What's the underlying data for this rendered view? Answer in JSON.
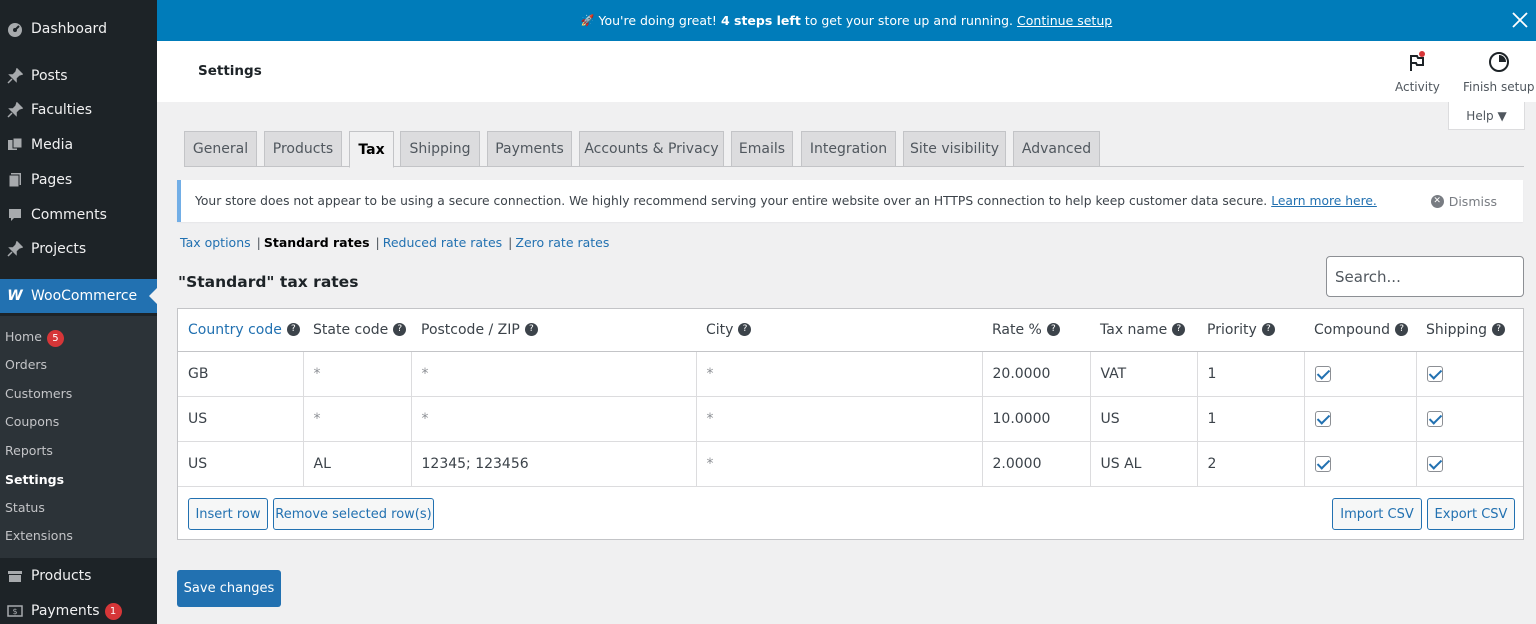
{
  "sidebar": {
    "items": [
      {
        "label": "Dashboard",
        "icon": "dashboard-icon"
      },
      {
        "label": "Posts",
        "icon": "pin-icon"
      },
      {
        "label": "Faculties",
        "icon": "pin-icon"
      },
      {
        "label": "Media",
        "icon": "media-icon"
      },
      {
        "label": "Pages",
        "icon": "pages-icon"
      },
      {
        "label": "Comments",
        "icon": "comments-icon"
      },
      {
        "label": "Projects",
        "icon": "pin-icon"
      },
      {
        "label": "WooCommerce",
        "icon": "woo-icon"
      },
      {
        "label": "Products",
        "icon": "products-icon"
      },
      {
        "label": "Payments",
        "icon": "payments-icon",
        "badge": "1"
      }
    ],
    "submenu": [
      {
        "label": "Home",
        "badge": "5"
      },
      {
        "label": "Orders"
      },
      {
        "label": "Customers"
      },
      {
        "label": "Coupons"
      },
      {
        "label": "Reports"
      },
      {
        "label": "Settings",
        "current": true
      },
      {
        "label": "Status"
      },
      {
        "label": "Extensions"
      }
    ]
  },
  "banner": {
    "emoji": "🚀",
    "text_pre": "You're doing great!",
    "text_bold": "4 steps left",
    "text_post": "to get your store up and running.",
    "link": "Continue setup"
  },
  "header": {
    "title": "Settings",
    "activity_label": "Activity",
    "finish_label": "Finish setup",
    "help_label": "Help ▼"
  },
  "tabs": [
    "General",
    "Products",
    "Tax",
    "Shipping",
    "Payments",
    "Accounts & Privacy",
    "Emails",
    "Integration",
    "Site visibility",
    "Advanced"
  ],
  "active_tab": "Tax",
  "notice": {
    "text": "Your store does not appear to be using a secure connection. We highly recommend serving your entire website over an HTTPS connection to help keep customer data secure.",
    "link": "Learn more here.",
    "dismiss": "Dismiss"
  },
  "subsub": {
    "tax_options": "Tax options",
    "standard": "Standard rates",
    "reduced": "Reduced rate rates",
    "zero": "Zero rate rates"
  },
  "rates_title": "\"Standard\" tax rates",
  "search_placeholder": "Search...",
  "table": {
    "headers": [
      "Country code",
      "State code",
      "Postcode / ZIP",
      "City",
      "Rate %",
      "Tax name",
      "Priority",
      "Compound",
      "Shipping"
    ],
    "rows": [
      {
        "country": "GB",
        "state": "*",
        "postcode": "*",
        "city": "*",
        "rate": "20.0000",
        "name": "VAT",
        "priority": "1",
        "compound": true,
        "shipping": true
      },
      {
        "country": "US",
        "state": "*",
        "postcode": "*",
        "city": "*",
        "rate": "10.0000",
        "name": "US",
        "priority": "1",
        "compound": true,
        "shipping": true
      },
      {
        "country": "US",
        "state": "AL",
        "postcode": "12345; 123456",
        "city": "*",
        "rate": "2.0000",
        "name": "US AL",
        "priority": "2",
        "compound": true,
        "shipping": true
      }
    ]
  },
  "buttons": {
    "insert": "Insert row",
    "remove": "Remove selected row(s)",
    "import": "Import CSV",
    "export": "Export CSV",
    "save": "Save changes"
  },
  "colors": {
    "wp_blue": "#2271b1",
    "banner": "#007cba",
    "admin_dark": "#1d2327"
  }
}
